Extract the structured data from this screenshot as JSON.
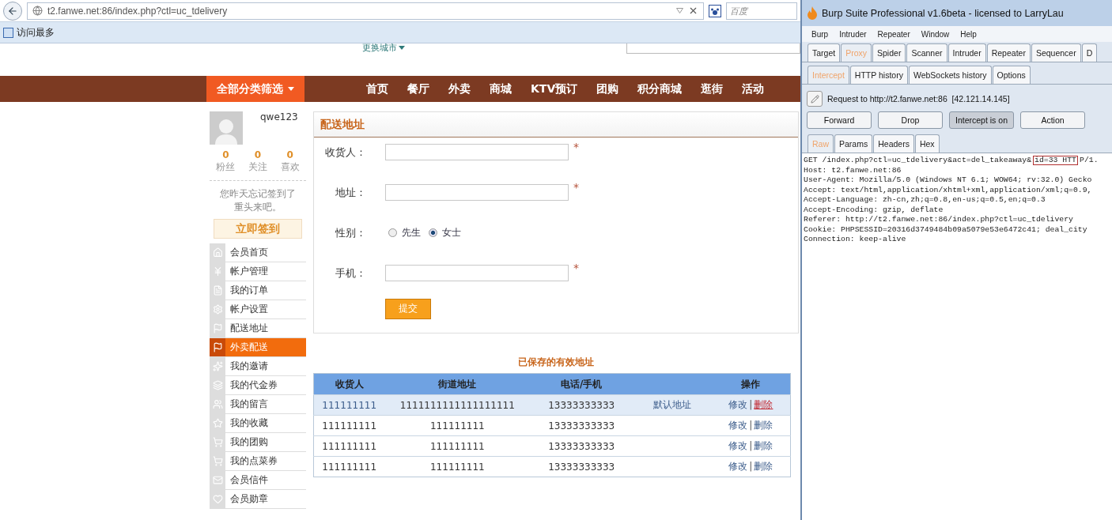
{
  "browser": {
    "url": "t2.fanwe.net:86/index.php?ctl=uc_tdelivery",
    "search": {
      "placeholder": "百度"
    },
    "bookmarks": [
      "访问最多"
    ]
  },
  "site": {
    "city_link": "更换城市",
    "category_button": "全部分类筛选",
    "nav": [
      {
        "label": "首页"
      },
      {
        "label": "餐厅"
      },
      {
        "label": "外卖"
      },
      {
        "label": "商城"
      },
      {
        "label": "KTV预订"
      },
      {
        "label": "团购"
      },
      {
        "label": "积分商城"
      },
      {
        "label": "逛街"
      },
      {
        "label": "活动"
      }
    ],
    "user": {
      "name": "qwe123",
      "stats": [
        {
          "value": "0",
          "label": "粉丝"
        },
        {
          "value": "0",
          "label": "关注"
        },
        {
          "value": "0",
          "label": "喜欢"
        }
      ],
      "checkin_notice": "您昨天忘记签到了重头来吧。",
      "checkin_button": "立即签到"
    },
    "menu": [
      {
        "label": "会员首页",
        "selected": false
      },
      {
        "label": "帐户管理",
        "selected": false
      },
      {
        "label": "我的订单",
        "selected": false
      },
      {
        "label": "帐户设置",
        "selected": false
      },
      {
        "label": "配送地址",
        "selected": false
      },
      {
        "label": "外卖配送",
        "selected": true
      },
      {
        "label": "我的邀请",
        "selected": false
      },
      {
        "label": "我的代金券",
        "selected": false
      },
      {
        "label": "我的留言",
        "selected": false
      },
      {
        "label": "我的收藏",
        "selected": false
      },
      {
        "label": "我的团购",
        "selected": false
      },
      {
        "label": "我的点菜券",
        "selected": false
      },
      {
        "label": "会员信件",
        "selected": false
      },
      {
        "label": "会员勋章",
        "selected": false
      }
    ],
    "form": {
      "title": "配送地址",
      "fields": [
        {
          "kind": "text",
          "label": "收货人：",
          "required_mark": "*"
        },
        {
          "kind": "text",
          "label": "地址：",
          "required_mark": "*"
        },
        {
          "kind": "radio",
          "label": "性别：",
          "options": [
            {
              "label": "先生",
              "selected": false
            },
            {
              "label": "女士",
              "selected": true
            }
          ]
        },
        {
          "kind": "text",
          "label": "手机：",
          "required_mark": "*"
        }
      ],
      "submit": "提交"
    },
    "table": {
      "title": "已保存的有效地址",
      "columns": [
        {
          "label": "收货人"
        },
        {
          "label": "街道地址"
        },
        {
          "label": "电话/手机"
        },
        {},
        {
          "label": "操作"
        }
      ],
      "rows": [
        {
          "highlighted": true,
          "cells": [
            "111111111",
            "1111111111111111111",
            "13333333333",
            "默认地址"
          ],
          "actions": [
            {
              "kind": "link",
              "label": "修改",
              "hover": false
            },
            {
              "kind": "separator",
              "label": "|"
            },
            {
              "kind": "link",
              "label": "删除",
              "hover": true
            }
          ]
        },
        {
          "highlighted": false,
          "cells": [
            "111111111",
            "111111111",
            "13333333333"
          ],
          "actions": [
            {
              "kind": "link",
              "label": "修改",
              "hover": false
            },
            {
              "kind": "separator",
              "label": "|"
            },
            {
              "kind": "link",
              "label": "删除",
              "hover": false
            }
          ]
        },
        {
          "highlighted": false,
          "cells": [
            "111111111",
            "111111111",
            "13333333333"
          ],
          "actions": [
            {
              "kind": "link",
              "label": "修改",
              "hover": false
            },
            {
              "kind": "separator",
              "label": "|"
            },
            {
              "kind": "link",
              "label": "删除",
              "hover": false
            }
          ]
        },
        {
          "highlighted": false,
          "cells": [
            "111111111",
            "111111111",
            "13333333333"
          ],
          "actions": [
            {
              "kind": "link",
              "label": "修改",
              "hover": false
            },
            {
              "kind": "separator",
              "label": "|"
            },
            {
              "kind": "link",
              "label": "删除",
              "hover": false
            }
          ]
        }
      ]
    }
  },
  "burp": {
    "title": "Burp Suite Professional v1.6beta - licensed to LarryLau",
    "menu": [
      "Burp",
      "Intruder",
      "Repeater",
      "Window",
      "Help"
    ],
    "tabs": [
      {
        "label": "Target",
        "selected": false
      },
      {
        "label": "Proxy",
        "selected": true
      },
      {
        "label": "Spider",
        "selected": false
      },
      {
        "label": "Scanner",
        "selected": false
      },
      {
        "label": "Intruder",
        "selected": false
      },
      {
        "label": "Repeater",
        "selected": false
      },
      {
        "label": "Sequencer",
        "selected": false
      },
      {
        "label": "D",
        "selected": false
      }
    ],
    "subtabs": [
      {
        "label": "Intercept",
        "selected": true
      },
      {
        "label": "HTTP history",
        "selected": false
      },
      {
        "label": "WebSockets history",
        "selected": false
      },
      {
        "label": "Options",
        "selected": false
      }
    ],
    "request_target": "Request to http://t2.fanwe.net:86  [42.121.14.145]",
    "buttons": [
      {
        "label": "Forward",
        "pressed": false
      },
      {
        "label": "Drop",
        "pressed": false
      },
      {
        "label": "Intercept is on",
        "pressed": true
      },
      {
        "label": "Action",
        "pressed": false
      }
    ],
    "editor_tabs": [
      {
        "label": "Raw",
        "selected": true
      },
      {
        "label": "Params",
        "selected": false
      },
      {
        "label": "Headers",
        "selected": false
      },
      {
        "label": "Hex",
        "selected": false
      }
    ],
    "request_lines": [
      {
        "parts": [
          {
            "text": "GET /index.php?ctl=uc_tdelivery&act=del_takeaway&",
            "boxed": false
          },
          {
            "text": "id=33 HTT",
            "boxed": true
          },
          {
            "text": "P/1.",
            "boxed": false
          }
        ]
      },
      {
        "parts": [
          {
            "text": "Host: t2.fanwe.net:86",
            "boxed": false
          }
        ]
      },
      {
        "parts": [
          {
            "text": "User-Agent: Mozilla/5.0 (Windows NT 6.1; WOW64; rv:32.0) Gecko",
            "boxed": false
          }
        ]
      },
      {
        "parts": [
          {
            "text": "Accept: text/html,application/xhtml+xml,application/xml;q=0.9,",
            "boxed": false
          }
        ]
      },
      {
        "parts": [
          {
            "text": "Accept-Language: zh-cn,zh;q=0.8,en-us;q=0.5,en;q=0.3",
            "boxed": false
          }
        ]
      },
      {
        "parts": [
          {
            "text": "Accept-Encoding: gzip, deflate",
            "boxed": false
          }
        ]
      },
      {
        "parts": [
          {
            "text": "Referer: http://t2.fanwe.net:86/index.php?ctl=uc_tdelivery",
            "boxed": false
          }
        ]
      },
      {
        "parts": [
          {
            "text": "Cookie: PHPSESSID=20316d3749484b09a5079e53e6472c41; deal_city",
            "boxed": false
          }
        ]
      },
      {
        "parts": [
          {
            "text": "Connection: keep-alive",
            "boxed": false
          }
        ]
      }
    ]
  }
}
